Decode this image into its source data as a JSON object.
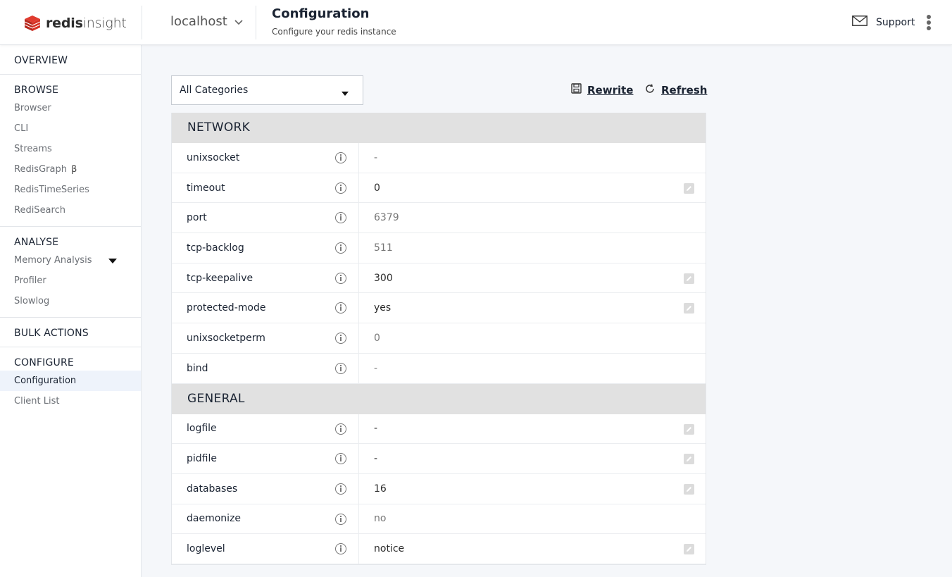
{
  "header": {
    "logo_bold": "redis",
    "logo_light": "insight",
    "host": "localhost",
    "title": "Configuration",
    "subtitle": "Configure your redis instance",
    "support_label": "Support"
  },
  "sidebar": {
    "overview": "OVERVIEW",
    "browse": {
      "heading": "BROWSE",
      "items": [
        "Browser",
        "CLI",
        "Streams",
        "RedisGraph",
        "RedisTimeSeries",
        "RediSearch"
      ],
      "beta": "β"
    },
    "analyse": {
      "heading": "ANALYSE",
      "items": [
        "Memory Analysis",
        "Profiler",
        "Slowlog"
      ]
    },
    "bulk": "BULK ACTIONS",
    "configure": {
      "heading": "CONFIGURE",
      "items": [
        "Configuration",
        "Client List"
      ]
    }
  },
  "toolbar": {
    "category_select": "All Categories",
    "rewrite_label": "Rewrite",
    "refresh_label": "Refresh"
  },
  "sections": [
    {
      "title": "NETWORK",
      "rows": [
        {
          "name": "unixsocket",
          "value": "-",
          "editable": false
        },
        {
          "name": "timeout",
          "value": "0",
          "editable": true
        },
        {
          "name": "port",
          "value": "6379",
          "editable": false
        },
        {
          "name": "tcp-backlog",
          "value": "511",
          "editable": false
        },
        {
          "name": "tcp-keepalive",
          "value": "300",
          "editable": true
        },
        {
          "name": "protected-mode",
          "value": "yes",
          "editable": true
        },
        {
          "name": "unixsocketperm",
          "value": "0",
          "editable": false
        },
        {
          "name": "bind",
          "value": "-",
          "editable": false
        }
      ]
    },
    {
      "title": "GENERAL",
      "rows": [
        {
          "name": "logfile",
          "value": "-",
          "editable": true
        },
        {
          "name": "pidfile",
          "value": "-",
          "editable": true
        },
        {
          "name": "databases",
          "value": "16",
          "editable": true
        },
        {
          "name": "daemonize",
          "value": "no",
          "editable": false
        },
        {
          "name": "loglevel",
          "value": "notice",
          "editable": true
        }
      ]
    }
  ]
}
